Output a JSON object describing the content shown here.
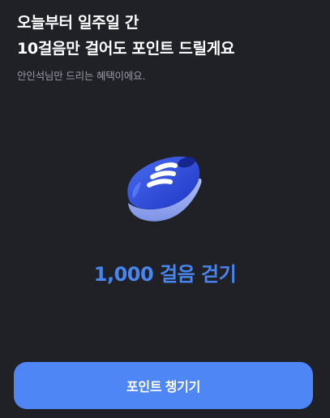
{
  "header": {
    "headline_line1": "오늘부터 일주일 간",
    "headline_line2": "10걸음만 걸어도 포인트 드릴게요",
    "subtitle": "안인석님만 드리는 혜택이에요."
  },
  "illustration": {
    "icon": "sneaker-icon"
  },
  "goal": {
    "label": "1,000 걸음 걷기"
  },
  "cta": {
    "label": "포인트 챙기기"
  },
  "colors": {
    "background": "#202127",
    "accent": "#4e86f5",
    "goal_text": "#4a86f0",
    "subtitle": "#9a9ca6"
  }
}
